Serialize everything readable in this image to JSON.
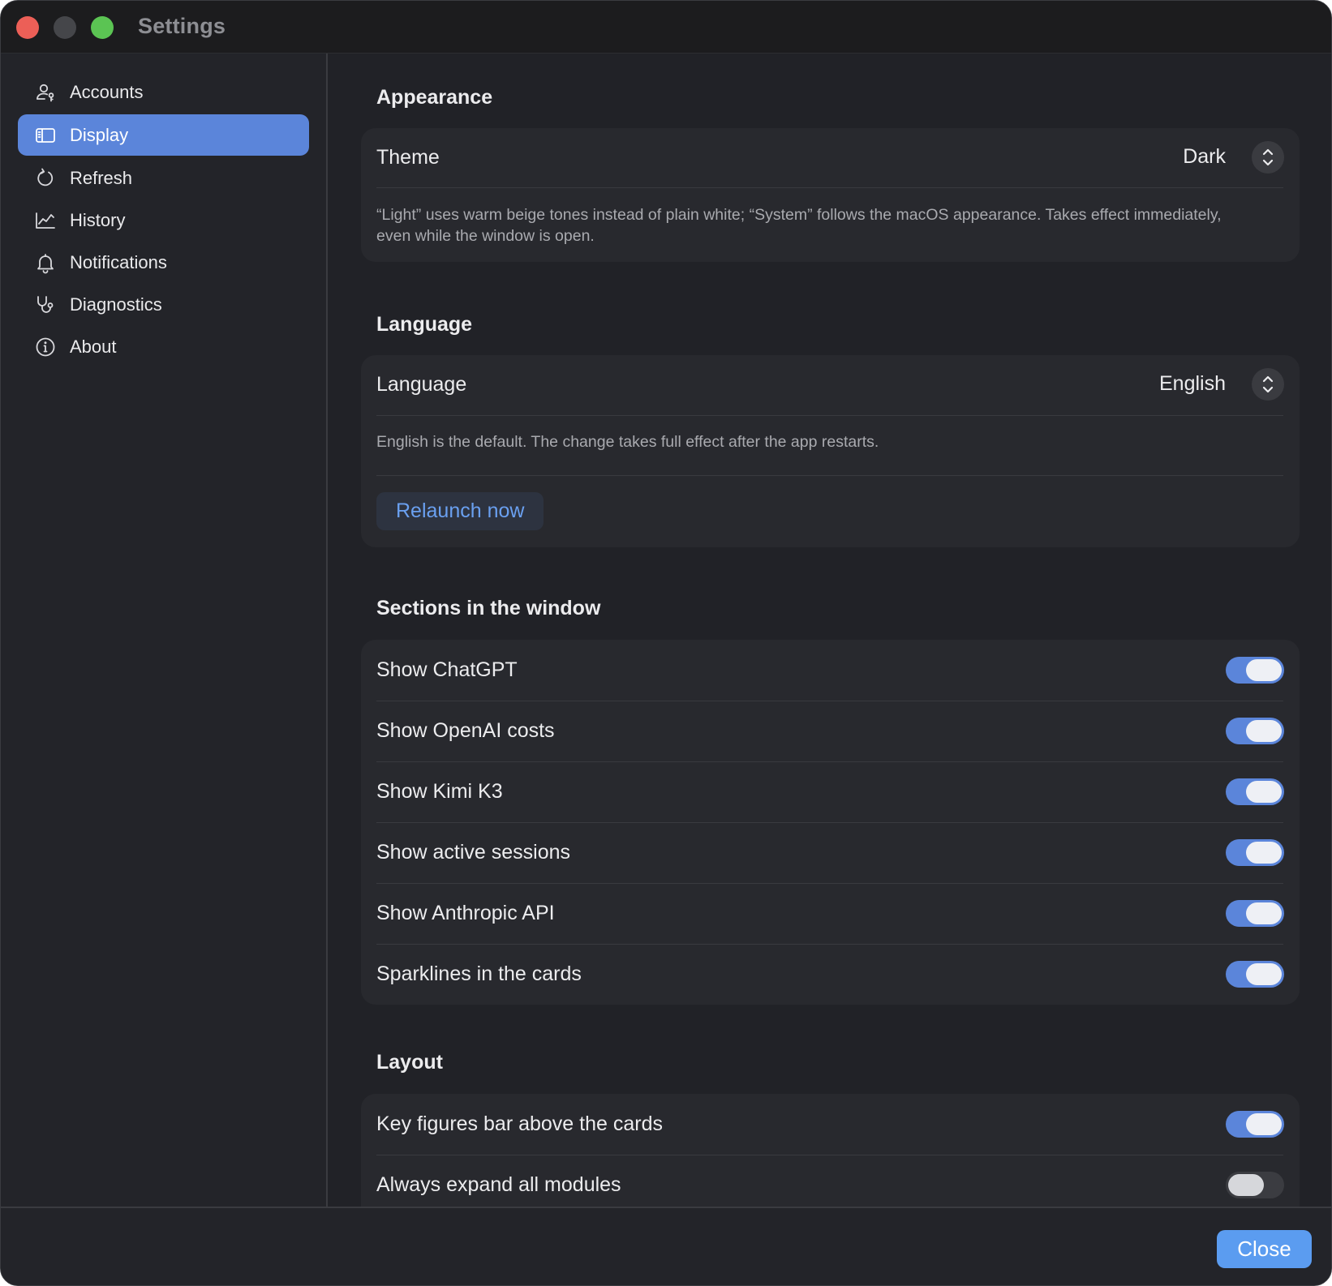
{
  "window": {
    "title": "Settings"
  },
  "sidebar": {
    "items": [
      {
        "label": "Accounts",
        "icon": "accounts-icon"
      },
      {
        "label": "Display",
        "icon": "display-icon",
        "active": true
      },
      {
        "label": "Refresh",
        "icon": "refresh-icon"
      },
      {
        "label": "History",
        "icon": "history-chart-icon"
      },
      {
        "label": "Notifications",
        "icon": "bell-icon"
      },
      {
        "label": "Diagnostics",
        "icon": "stethoscope-icon"
      },
      {
        "label": "About",
        "icon": "info-icon"
      }
    ]
  },
  "appearance": {
    "title": "Appearance",
    "theme_label": "Theme",
    "theme_value": "Dark",
    "help": "“Light” uses warm beige tones instead of plain white; “System” follows the macOS appearance. Takes effect immediately, even while the window is open."
  },
  "language": {
    "title": "Language",
    "label": "Language",
    "value": "English",
    "help": "English is the default. The change takes full effect after the app restarts.",
    "relaunch_label": "Relaunch now"
  },
  "sections": {
    "title": "Sections in the window",
    "toggles": [
      {
        "label": "Show ChatGPT",
        "on": true
      },
      {
        "label": "Show OpenAI costs",
        "on": true
      },
      {
        "label": "Show Kimi K3",
        "on": true
      },
      {
        "label": "Show active sessions",
        "on": true
      },
      {
        "label": "Show Anthropic API",
        "on": true
      },
      {
        "label": "Sparklines in the cards",
        "on": true
      }
    ]
  },
  "layout": {
    "title": "Layout",
    "toggles": [
      {
        "label": "Key figures bar above the cards",
        "on": true
      },
      {
        "label": "Always expand all modules",
        "on": false
      }
    ]
  },
  "footer": {
    "close_label": "Close"
  },
  "colors": {
    "accent": "#5b85da",
    "button": "#5b9cf0",
    "link": "#6aa0f0",
    "window_bg": "#232429"
  }
}
